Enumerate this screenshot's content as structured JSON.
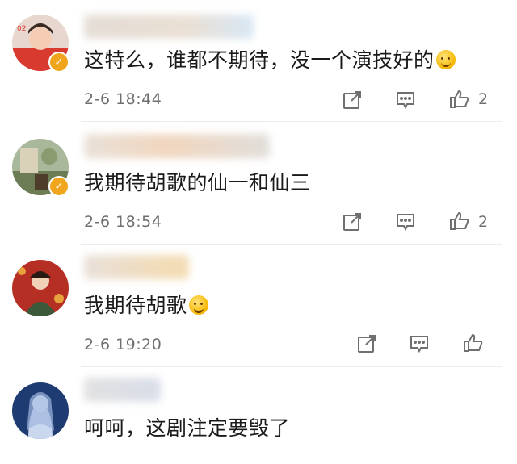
{
  "comments": [
    {
      "text": "这特么，谁都不期待，没一个演技好的",
      "time": "2-6 18:44",
      "likes": "2",
      "emoji": "laugh-emoji"
    },
    {
      "text": "我期待胡歌的仙一和仙三",
      "time": "2-6 18:54",
      "likes": "2"
    },
    {
      "text": "我期待胡歌",
      "time": "2-6 19:20",
      "likes": "",
      "emoji": "grin-emoji"
    },
    {
      "text": "呵呵，这剧注定要毁了"
    }
  ],
  "icons": {
    "share": "share-icon",
    "comment": "comment-icon",
    "like": "like-icon",
    "verified": "verified-badge-icon"
  }
}
